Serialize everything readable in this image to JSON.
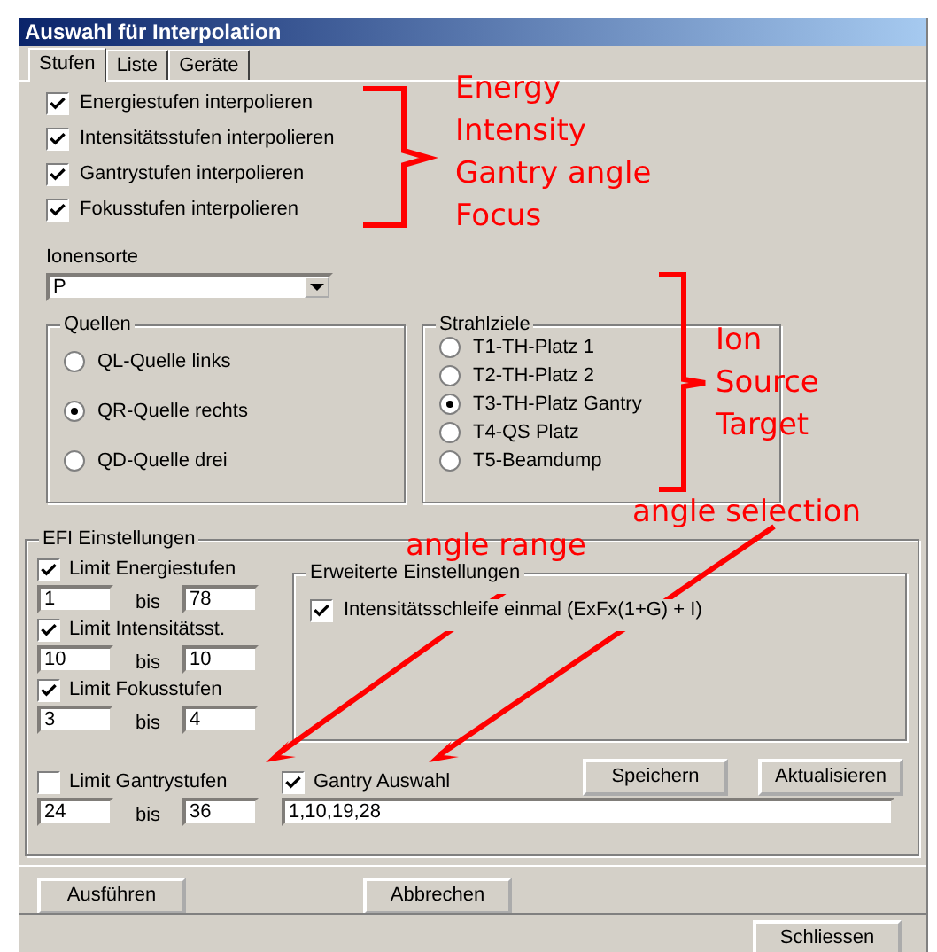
{
  "window": {
    "title": "Auswahl für Interpolation"
  },
  "tabs": [
    {
      "label": "Stufen",
      "selected": true
    },
    {
      "label": "Liste",
      "selected": false
    },
    {
      "label": "Geräte",
      "selected": false
    }
  ],
  "interpolation_options": [
    {
      "label": "Energiestufen interpolieren",
      "checked": true
    },
    {
      "label": "Intensitätsstufen interpolieren",
      "checked": true
    },
    {
      "label": "Gantrystufen interpolieren",
      "checked": true
    },
    {
      "label": "Fokusstufen interpolieren",
      "checked": true
    }
  ],
  "ion_type": {
    "label": "Ionensorte",
    "value": "P"
  },
  "sources": {
    "title": "Quellen",
    "options": [
      {
        "label": "QL-Quelle links",
        "selected": false
      },
      {
        "label": "QR-Quelle rechts",
        "selected": true
      },
      {
        "label": "QD-Quelle drei",
        "selected": false
      }
    ]
  },
  "targets": {
    "title": "Strahlziele",
    "options": [
      {
        "label": "T1-TH-Platz 1",
        "selected": false
      },
      {
        "label": "T2-TH-Platz 2",
        "selected": false
      },
      {
        "label": "T3-TH-Platz Gantry",
        "selected": true
      },
      {
        "label": "T4-QS Platz",
        "selected": false
      },
      {
        "label": "T5-Beamdump",
        "selected": false
      }
    ]
  },
  "efi_settings": {
    "title": "EFI Einstellungen",
    "limits": [
      {
        "label": "Limit Energiestufen",
        "checked": true,
        "from": "1",
        "between": "bis",
        "to": "78"
      },
      {
        "label": "Limit Intensitätsst.",
        "checked": true,
        "from": "10",
        "between": "bis",
        "to": "10"
      },
      {
        "label": "Limit Fokusstufen",
        "checked": true,
        "from": "3",
        "between": "bis",
        "to": "4"
      },
      {
        "label": "Limit Gantrystufen",
        "checked": false,
        "from": "24",
        "between": "bis",
        "to": "36"
      }
    ],
    "extended": {
      "title": "Erweiterte Einstellungen",
      "options": [
        {
          "label": "Intensitätsschleife einmal (ExFx(1+G) + I)",
          "checked": true
        }
      ]
    },
    "gantry_selection": {
      "label": "Gantry Auswahl",
      "checked": true,
      "value": "1,10,19,28"
    },
    "buttons": [
      "Speichern",
      "Aktualisieren"
    ]
  },
  "actions": [
    "Ausführen",
    "Abbrechen"
  ],
  "close_button": "Schliessen",
  "annotations": [
    {
      "kind": "brace",
      "lines": [
        "Energy",
        "Intensity",
        "Gantry angle",
        "Focus"
      ]
    },
    {
      "kind": "brace",
      "lines": [
        "Ion",
        "Source",
        "Target"
      ]
    },
    {
      "kind": "arrow",
      "text": "angle range"
    },
    {
      "kind": "arrow",
      "text": "angle selection"
    }
  ]
}
